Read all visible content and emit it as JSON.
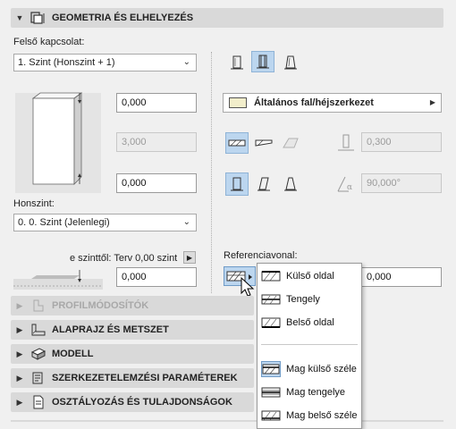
{
  "geometry_header": {
    "title": "GEOMETRIA ÉS ELHELYEZÉS"
  },
  "left": {
    "top_link_label": "Felső kapcsolat:",
    "top_link_value": "1. Szint (Honszint + 1)",
    "height_value": "0,000",
    "thickness_value": "3,000",
    "bottom_offset_value": "0,000",
    "home_story_label": "Honszint:",
    "home_story_value": "0. 0. Szint (Jelenlegi)",
    "from_story_label": "e szinttől: Terv 0,00 szint",
    "from_story_value": "0,000"
  },
  "right": {
    "composite_label": "Általános fal/héjszerkezet",
    "thickness_value": "0,300",
    "angle_value": "90,000°",
    "refline_label": "Referenciavonal:",
    "refline_offset_value": "0,000"
  },
  "sections": [
    {
      "title": "PROFILMÓDOSÍTÓK",
      "icon": "profile-icon",
      "enabled": false
    },
    {
      "title": "ALAPRAJZ ÉS METSZET",
      "icon": "floorplan-icon",
      "enabled": true
    },
    {
      "title": "MODELL",
      "icon": "model-icon",
      "enabled": true
    },
    {
      "title": "SZERKEZETELEMZÉSI PARAMÉTEREK",
      "icon": "structural-icon",
      "enabled": true
    },
    {
      "title": "OSZTÁLYOZÁS ÉS TULAJDONSÁGOK",
      "icon": "classification-icon",
      "enabled": true
    }
  ],
  "refline_menu": {
    "items": [
      {
        "label": "Külső oldal"
      },
      {
        "label": "Tengely"
      },
      {
        "label": "Belső oldal"
      },
      {
        "label": "Mag külső széle"
      },
      {
        "label": "Mag tengelye"
      },
      {
        "label": "Mag belső széle"
      }
    ],
    "selected_index": 3
  },
  "colors": {
    "selected_button": "#bcd6ef",
    "section_bar": "#d9d9d9",
    "composite_swatch": "#f2eecb"
  }
}
